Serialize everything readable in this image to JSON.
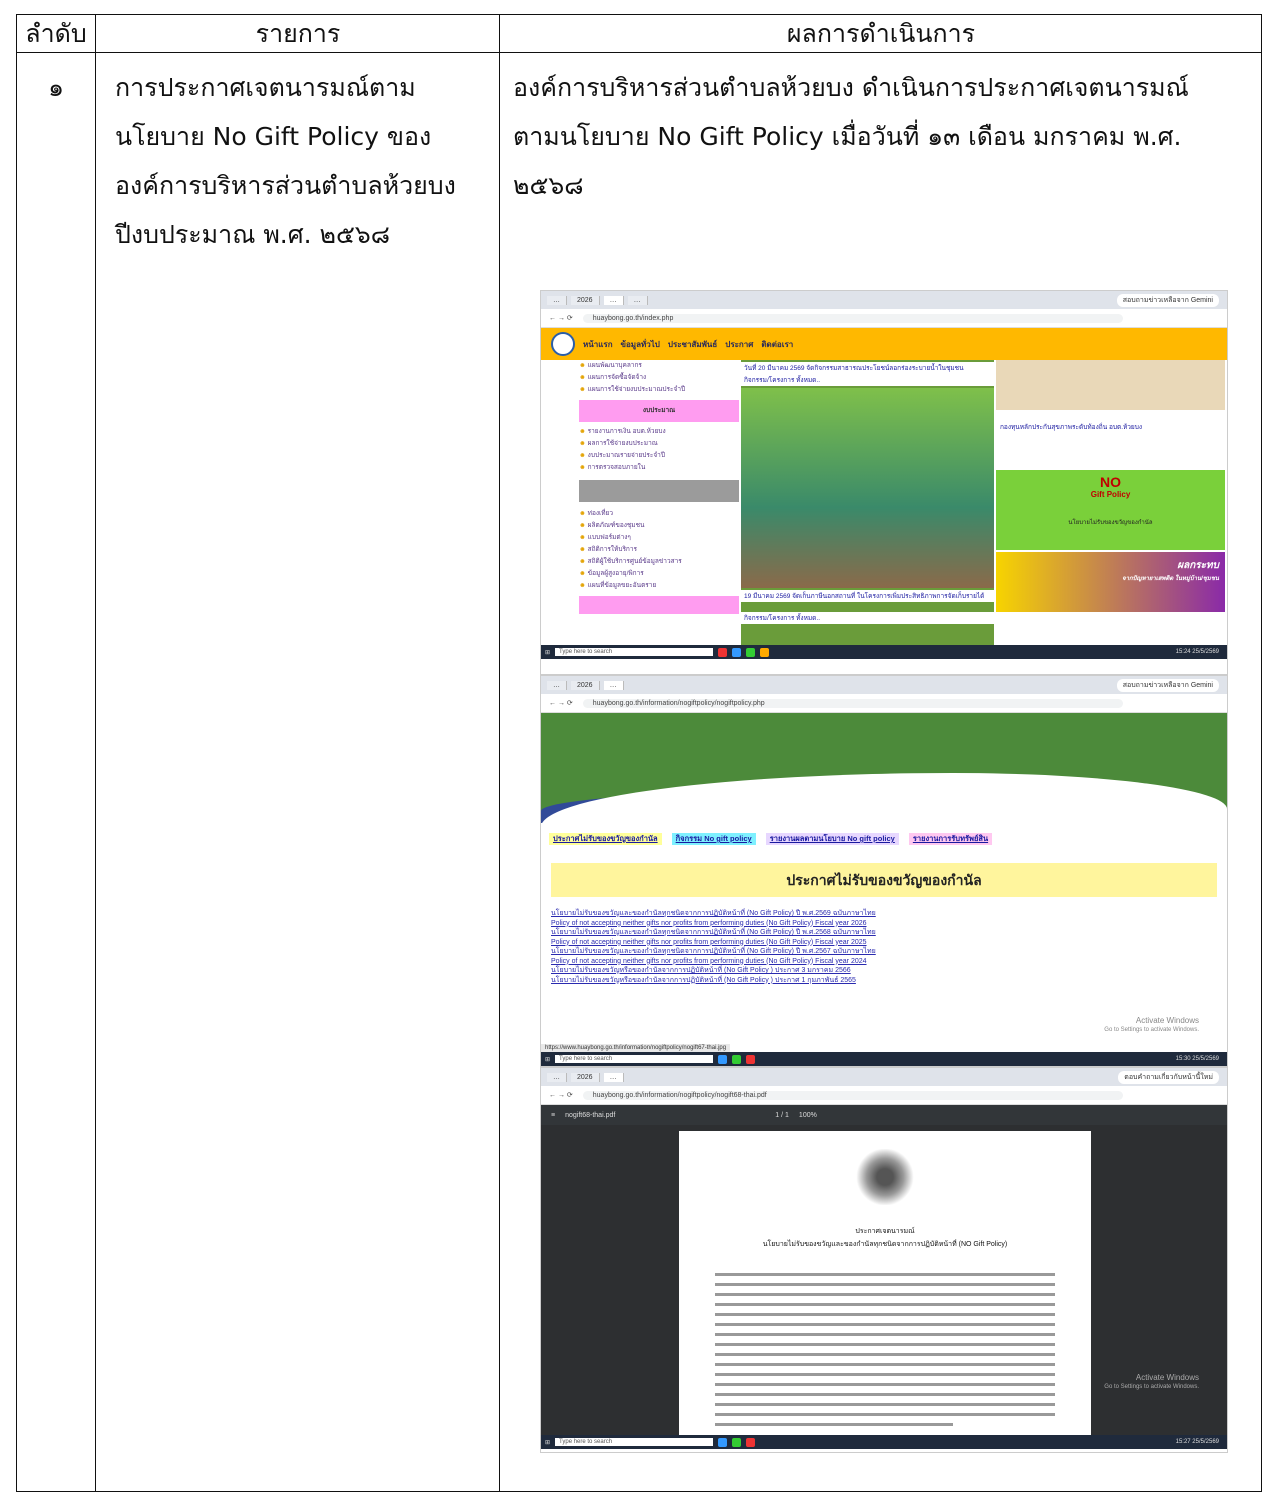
{
  "table": {
    "headers": [
      "ลำดับ",
      "รายการ",
      "ผลการดำเนินการ"
    ],
    "row": {
      "number": "๑",
      "item_lines": [
        "การประกาศเจตนารมณ์ตาม",
        "นโยบาย No Gift Policy ของ",
        "องค์การบริหารส่วนตำบลห้วยบง",
        "ปีงบประมาณ พ.ศ. ๒๕๖๘"
      ],
      "result_lines": [
        "องค์การบริหารส่วนตำบลห้วยบง ดำเนินการประกาศเจตนารมณ์",
        "ตามนโยบาย No Gift Policy เมื่อวันที่ ๑๓ เดือน มกราคม พ.ศ.",
        "๒๕๖๘"
      ]
    }
  },
  "shot1": {
    "url": "huaybong.go.th/index.php",
    "gemini": "สอบถามข่าวเหลือจาก Gemini",
    "nav": [
      "หน้าแรก",
      "ข้อมูลทั่วไป",
      "ประชาสัมพันธ์",
      "ประกาศ",
      "ติดต่อเรา"
    ],
    "left_items_top": [
      "แผนพัฒนาบุคลากร",
      "แผนการจัดซื้อจัดจ้าง",
      "แผนการใช้จ่ายงบประมาณประจำปี"
    ],
    "left_heading": "งบประมาณ",
    "left_items_mid": [
      "รายงานการเงิน อบต.ห้วยบง",
      "ผลการใช้จ่ายงบประมาณ",
      "งบประมาณรายจ่ายประจำปี",
      "การตรวจสอบภายใน"
    ],
    "left_items_bottom": [
      "ท่องเที่ยว",
      "ผลิตภัณฑ์ของชุมชน",
      "แบบฟอร์มต่างๆ",
      "สถิติการให้บริการ",
      "สถิติผู้ใช้บริการศูนย์ข้อมูลข่าวสาร",
      "ข้อมูลผู้สูงอายุ/พิการ",
      "แผนที่ข้อมูลขยะอันตราย"
    ],
    "news_top": "วันที่ 20 มีนาคม 2569 จัดกิจกรรมสาธารณประโยชน์ลอกร่องระบายน้ำในชุมชน",
    "news_top_link": "กิจกรรม/โครงการ ทั้งหมด..",
    "news_bottom": "19 มีนาคม 2569 จัดเก็บภาษีนอกสถานที่ ในโครงการเพิ่มประสิทธิภาพการจัดเก็บรายได้",
    "news_bottom_link": "กิจกรรม/โครงการ ทั้งหมด..",
    "right_fund": "กองทุนหลักประกันสุขภาพระดับท้องถิ่น อบต.ห้วยบง",
    "nogift_big": "NO",
    "nogift_small": "Gift Policy",
    "nogift_caption": "นโยบายไม่รับของขวัญของกำนัล",
    "poster_text": "ผลกระทบ",
    "poster_sub": "จากปัญหายาเสพติด ในหมู่บ้าน/ชุมชน",
    "search": "Type here to search",
    "clock": "15:24 25/5/2569"
  },
  "shot2": {
    "url": "huaybong.go.th/information/nogiftpolicy/nogiftpolicy.php",
    "links": [
      "ประกาศไม่รับของขวัญของกำนัล",
      "กิจกรรม No gift policy",
      "รายงานผลตามนโยบาย No gift policy",
      "รายงานการรับทรัพย์สิน"
    ],
    "title": "ประกาศไม่รับของขวัญของกำนัล",
    "list": [
      "นโยบายไม่รับของขวัญและของกำนัลทุกชนิดจากการปฏิบัติหน้าที่ (No Gift Policy) ปี พ.ศ.2569 ฉบับภาษาไทย",
      "Policy of not accepting neither gifts nor profits from performing duties (No Gift Policy) Fiscal year 2026",
      "นโยบายไม่รับของขวัญและของกำนัลทุกชนิดจากการปฏิบัติหน้าที่ (No Gift Policy) ปี พ.ศ.2568 ฉบับภาษาไทย",
      "Policy of not accepting neither gifts nor profits from performing duties (No Gift Policy) Fiscal year 2025",
      "นโยบายไม่รับของขวัญและของกำนัลทุกชนิดจากการปฏิบัติหน้าที่ (No Gift Policy) ปี พ.ศ.2567 ฉบับภาษาไทย",
      "Policy of not accepting neither gifts nor profits from performing duties (No Gift Policy) Fiscal year 2024",
      "นโยบายไม่รับของขวัญหรือของกำนัลจากการปฏิบัติหน้าที่ (No Gift Policy ) ประกาศ 3 มกราคม 2566",
      "นโยบายไม่รับของขวัญหรือของกำนัลจากการปฏิบัติหน้าที่ (No Gift Policy ) ประกาศ 1 กุมภาพันธ์ 2565"
    ],
    "activate_title": "Activate Windows",
    "activate_sub": "Go to Settings to activate Windows.",
    "status_url": "https://www.huaybong.go.th/information/nogiftpolicy/nogift67-thai.jpg",
    "search": "Type here to search",
    "clock": "15:30 25/5/2569"
  },
  "shot3": {
    "url": "huaybong.go.th/information/nogiftpolicy/nogift68-thai.pdf",
    "gemini": "ตอบคำถามเกี่ยวกับหน้านี้ใหม่",
    "filename": "nogift68-thai.pdf",
    "page": "1 / 1",
    "zoom": "100%",
    "doc_title": "ประกาศเจตนารมณ์",
    "doc_subtitle": "นโยบายไม่รับของขวัญและของกำนัลทุกชนิดจากการปฏิบัติหน้าที่ (NO Gift Policy)",
    "activate_title": "Activate Windows",
    "activate_sub": "Go to Settings to activate Windows.",
    "search": "Type here to search",
    "clock": "15:27 25/5/2569"
  }
}
